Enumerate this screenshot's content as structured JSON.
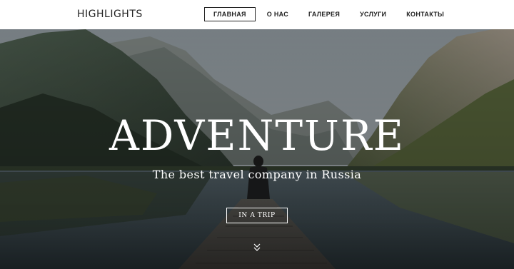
{
  "header": {
    "logo": "HIGHLIGHTS",
    "nav": [
      {
        "label": "ГЛАВНАЯ",
        "active": true
      },
      {
        "label": "О НАС",
        "active": false
      },
      {
        "label": "ГАЛЕРЕЯ",
        "active": false
      },
      {
        "label": "УСЛУГИ",
        "active": false
      },
      {
        "label": "КОНТАКТЫ",
        "active": false
      }
    ]
  },
  "hero": {
    "title": "ADVENTURE",
    "subtitle": "The best travel company in Russia",
    "button_label": "IN A TRIP",
    "scroll_icon": "double-chevron-down-icon"
  },
  "colors": {
    "header_bg": "#ffffff",
    "text_dark": "#222222",
    "hero_text": "#ffffff"
  }
}
